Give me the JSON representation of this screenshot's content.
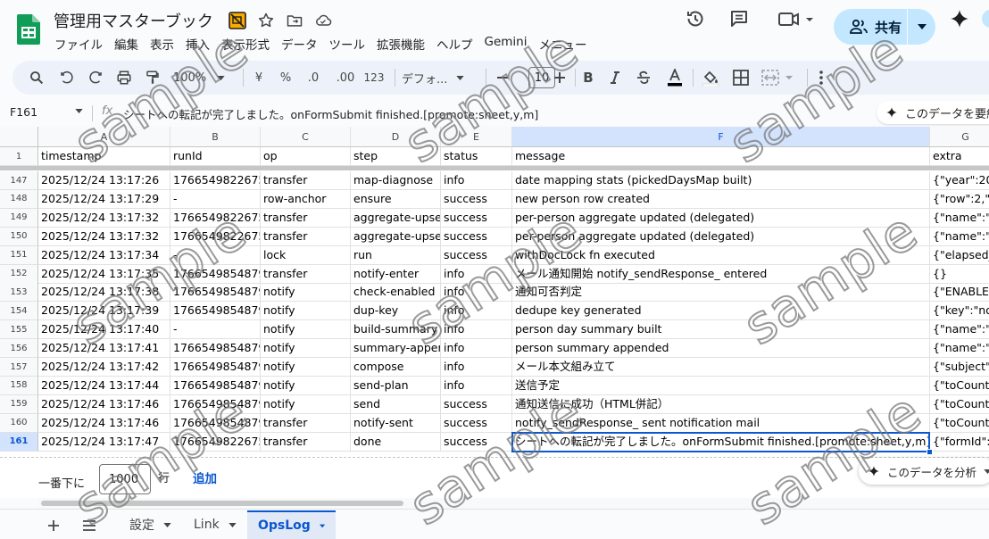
{
  "title_bar": {
    "doc_title": "管理用マスターブック",
    "share_label": "共有"
  },
  "menu": [
    "ファイル",
    "編集",
    "表示",
    "挿入",
    "表示形式",
    "データ",
    "ツール",
    "拡張機能",
    "ヘルプ",
    "Gemini",
    "メニュー"
  ],
  "toolbar": {
    "zoom": "100%",
    "currency": "¥",
    "percent": "%",
    "dec_decrease": ".0",
    "dec_increase": ".00",
    "number_format": "123",
    "font_name": "デフォ...",
    "font_size": "10",
    "bold": "B"
  },
  "formula_bar": {
    "name_box": "F161",
    "fx": "fx",
    "formula": "シートへの転記が完了しました。onFormSubmit finished.[promote:sheet,y,m]",
    "ai_chip": "このデータを要約"
  },
  "grid": {
    "column_letters": [
      "A",
      "B",
      "C",
      "D",
      "E",
      "F",
      "G"
    ],
    "selected_column": "F",
    "header_row_number": "1",
    "headers": [
      "timestamp",
      "runId",
      "op",
      "step",
      "status",
      "message",
      "extra"
    ],
    "selected_row": "161",
    "rows": [
      {
        "num": "147",
        "cells": [
          "2025/12/24 13:17:26",
          "1766549822675",
          "transfer",
          "map-diagnose",
          "info",
          "date mapping stats (pickedDaysMap built)",
          "{\"year\":202"
        ]
      },
      {
        "num": "148",
        "cells": [
          "2025/12/24 13:17:29",
          "-",
          "row-anchor",
          "ensure",
          "success",
          "new person row created",
          "{\"row\":2,\"n"
        ]
      },
      {
        "num": "149",
        "cells": [
          "2025/12/24 13:17:32",
          "1766549822675",
          "transfer",
          "aggregate-upser",
          "success",
          "per-person aggregate updated (delegated)",
          "{\"name\":\"テ"
        ]
      },
      {
        "num": "150",
        "cells": [
          "2025/12/24 13:17:32",
          "1766549822675",
          "transfer",
          "aggregate-upser",
          "success",
          "per-person aggregate updated (delegated)",
          "{\"name\":\"テ"
        ]
      },
      {
        "num": "151",
        "cells": [
          "2025/12/24 13:17:34",
          "-",
          "lock",
          "run",
          "success",
          "withDocLock fn executed",
          "{\"elapsed_"
        ]
      },
      {
        "num": "152",
        "cells": [
          "2025/12/24 13:17:35",
          "1766549854879",
          "transfer",
          "notify-enter",
          "info",
          "メール通知開始 notify_sendResponse_ entered",
          "{}"
        ]
      },
      {
        "num": "153",
        "cells": [
          "2025/12/24 13:17:38",
          "1766549854879",
          "notify",
          "check-enabled",
          "info",
          "通知可否判定",
          "{\"ENABLE"
        ]
      },
      {
        "num": "154",
        "cells": [
          "2025/12/24 13:17:39",
          "1766549854879",
          "notify",
          "dup-key",
          "info",
          "dedupe key generated",
          "{\"key\":\"not"
        ]
      },
      {
        "num": "155",
        "cells": [
          "2025/12/24 13:17:40",
          "-",
          "notify",
          "build-summary",
          "info",
          "person day summary built",
          "{\"name\":\"テ"
        ]
      },
      {
        "num": "156",
        "cells": [
          "2025/12/24 13:17:41",
          "1766549854879",
          "notify",
          "summary-appen",
          "info",
          "person summary appended",
          "{\"name\":\"テ"
        ]
      },
      {
        "num": "157",
        "cells": [
          "2025/12/24 13:17:42",
          "1766549854879",
          "notify",
          "compose",
          "info",
          "メール本文組み立て",
          "{\"subject\":\""
        ]
      },
      {
        "num": "158",
        "cells": [
          "2025/12/24 13:17:44",
          "1766549854879",
          "notify",
          "send-plan",
          "info",
          "送信予定",
          "{\"toCount\""
        ]
      },
      {
        "num": "159",
        "cells": [
          "2025/12/24 13:17:46",
          "1766549854879",
          "notify",
          "send",
          "success",
          "通知送信に成功（HTML併記）",
          "{\"toCount\""
        ]
      },
      {
        "num": "160",
        "cells": [
          "2025/12/24 13:17:46",
          "1766549854879",
          "transfer",
          "notify-sent",
          "success",
          "notify_sendResponse_ sent notification mail",
          "{\"toCount\""
        ]
      },
      {
        "num": "161",
        "cells": [
          "2025/12/24 13:17:47",
          "1766549822675",
          "transfer",
          "done",
          "success",
          "シートへの転記が完了しました。onFormSubmit finished.[promote:sheet,y,m]",
          "{\"formId\":\""
        ]
      }
    ]
  },
  "add_rows": {
    "label": "一番下に",
    "count": "1000",
    "unit": "行",
    "button": "追加",
    "analyze_chip": "このデータを分析"
  },
  "sheet_tabs": [
    {
      "label": "設定",
      "active": false
    },
    {
      "label": "Link",
      "active": false
    },
    {
      "label": "OpsLog",
      "active": true
    }
  ],
  "watermark": "sample",
  "colors": {
    "accent": "#0b57d0",
    "share_bg": "#c2e7ff",
    "toolbar_bg": "#edf2fa",
    "sheets_green": "#0f9d58"
  }
}
